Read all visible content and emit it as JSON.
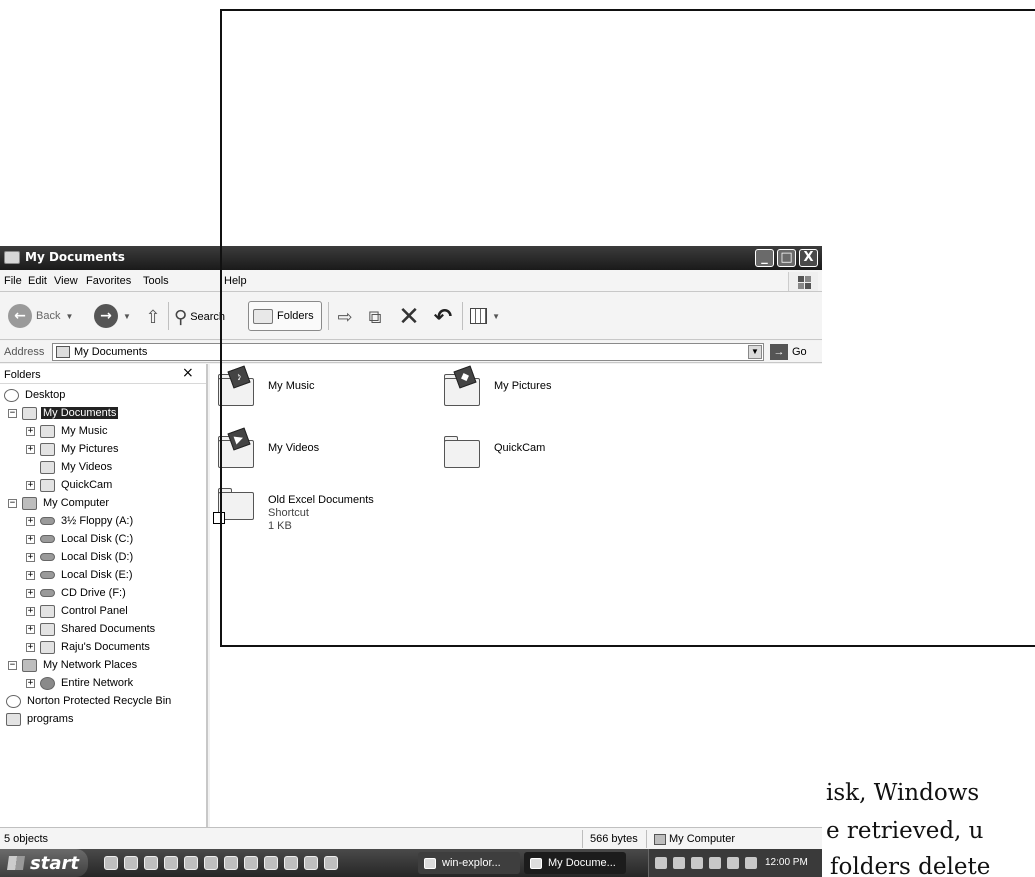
{
  "window": {
    "title": "My Documents",
    "buttons": {
      "minimize": "_",
      "maximize": "□",
      "close": "X"
    }
  },
  "menu": [
    "File",
    "Edit",
    "View",
    "Favorites",
    "Tools",
    "Help"
  ],
  "toolbar": {
    "back_label": "Back",
    "search_label": "Search",
    "folders_label": "Folders"
  },
  "address": {
    "label": "Address",
    "value": "My Documents",
    "go_label": "Go"
  },
  "folders_pane": {
    "title": "Folders",
    "close": "×",
    "tree": [
      {
        "label": "Desktop",
        "icon": "desktop-icon",
        "expander": ""
      },
      {
        "label": "My Documents",
        "icon": "documents-icon",
        "expander": "−",
        "selected": true
      },
      {
        "label": "My Music",
        "icon": "music-folder-icon",
        "expander": "+"
      },
      {
        "label": "My Pictures",
        "icon": "pictures-folder-icon",
        "expander": "+"
      },
      {
        "label": "My Videos",
        "icon": "videos-folder-icon",
        "expander": ""
      },
      {
        "label": "QuickCam",
        "icon": "folder-icon",
        "expander": "+"
      },
      {
        "label": "My Computer",
        "icon": "computer-icon",
        "expander": "−"
      },
      {
        "label": "3½ Floppy (A:)",
        "icon": "floppy-icon",
        "expander": "+"
      },
      {
        "label": "Local Disk (C:)",
        "icon": "disk-icon",
        "expander": "+"
      },
      {
        "label": "Local Disk (D:)",
        "icon": "disk-icon",
        "expander": "+"
      },
      {
        "label": "Local Disk (E:)",
        "icon": "disk-icon",
        "expander": "+"
      },
      {
        "label": "CD Drive (F:)",
        "icon": "cd-drive-icon",
        "expander": "+"
      },
      {
        "label": "Control Panel",
        "icon": "control-panel-icon",
        "expander": "+"
      },
      {
        "label": "Shared Documents",
        "icon": "folder-icon",
        "expander": "+"
      },
      {
        "label": "Raju's Documents",
        "icon": "folder-icon",
        "expander": "+"
      },
      {
        "label": "My Network Places",
        "icon": "network-icon",
        "expander": "−"
      },
      {
        "label": "Entire Network",
        "icon": "globe-icon",
        "expander": "+"
      },
      {
        "label": "Norton Protected Recycle Bin",
        "icon": "recycle-bin-icon",
        "expander": ""
      },
      {
        "label": "programs",
        "icon": "folder-icon",
        "expander": ""
      }
    ]
  },
  "content_items": [
    {
      "name": "My Music",
      "badge": "♪"
    },
    {
      "name": "My Pictures",
      "badge": "◆"
    },
    {
      "name": "My Videos",
      "badge": "▶"
    },
    {
      "name": "QuickCam",
      "badge": ""
    },
    {
      "name": "Old Excel Documents",
      "detail1": "Shortcut",
      "detail2": "1 KB",
      "shortcut": true
    }
  ],
  "status": {
    "objects": "5 objects",
    "size": "566 bytes",
    "location": "My Computer"
  },
  "taskbar": {
    "start_label": "start",
    "tasks": [
      "win-explor...",
      "My Docume..."
    ],
    "clock": "12:00 PM"
  },
  "page_text": [
    "isk, Windows",
    "e retrieved, u",
    "folders delete"
  ]
}
